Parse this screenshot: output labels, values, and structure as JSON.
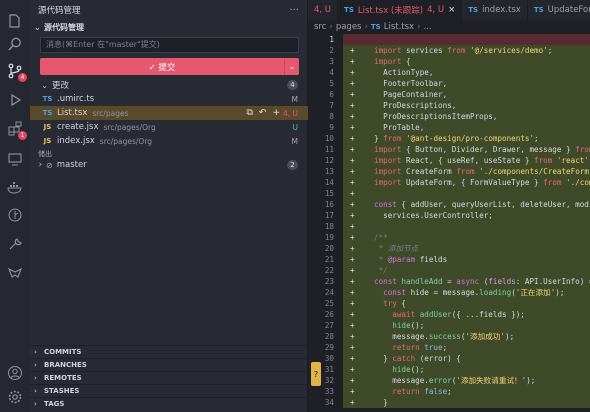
{
  "activity": {
    "scm_badge": "4",
    "ext_badge": "1"
  },
  "sidebar": {
    "title": "源代码管理",
    "section_title": "源代码管理",
    "message_placeholder": "消息(⌘Enter 在\"master\"提交)",
    "commit_label": "✓ 提交",
    "changes_label": "更改",
    "changes_count": "4",
    "files": [
      {
        "type": "TS",
        "name": ".umirc.ts",
        "path": "",
        "status": "M"
      },
      {
        "type": "TS",
        "name": "List.tsx",
        "path": "src/pages",
        "status": "4, U"
      },
      {
        "type": "JS",
        "name": "create.jsx",
        "path": "src/pages/Org",
        "status": "U"
      },
      {
        "type": "JS",
        "name": "index.jsx",
        "path": "src/pages/Org",
        "status": "M"
      }
    ],
    "stash_label": "储出",
    "branch_label": "master",
    "branch_count": "2",
    "bottom_sections": [
      "COMMITS",
      "BRANCHES",
      "REMOTES",
      "STASHES",
      "TAGS"
    ]
  },
  "editor": {
    "tabs": [
      {
        "label": "4, U",
        "active": false
      },
      {
        "label": "List.tsx (未跟踪)",
        "badge": "4, U",
        "active": true
      },
      {
        "label": "index.tsx",
        "active": false
      },
      {
        "label": "UpdateForm.",
        "active": false
      }
    ],
    "breadcrumb": [
      "src",
      "pages",
      "List.tsx"
    ],
    "line_numbers": [
      "1",
      "2",
      "3",
      "4",
      "5",
      "6",
      "7",
      "8",
      "9",
      "10",
      "11",
      "12",
      "13",
      "14",
      "15",
      "16",
      "17",
      "18",
      "19",
      "20",
      "21",
      "22",
      "23",
      "24",
      "25",
      "26",
      "27",
      "28",
      "29",
      "30",
      "31",
      "32",
      "33",
      "34"
    ]
  },
  "colors": {
    "accent": "#e5586f",
    "added_bg": "#3f4a28",
    "deleted_bg": "#5a2a33"
  }
}
